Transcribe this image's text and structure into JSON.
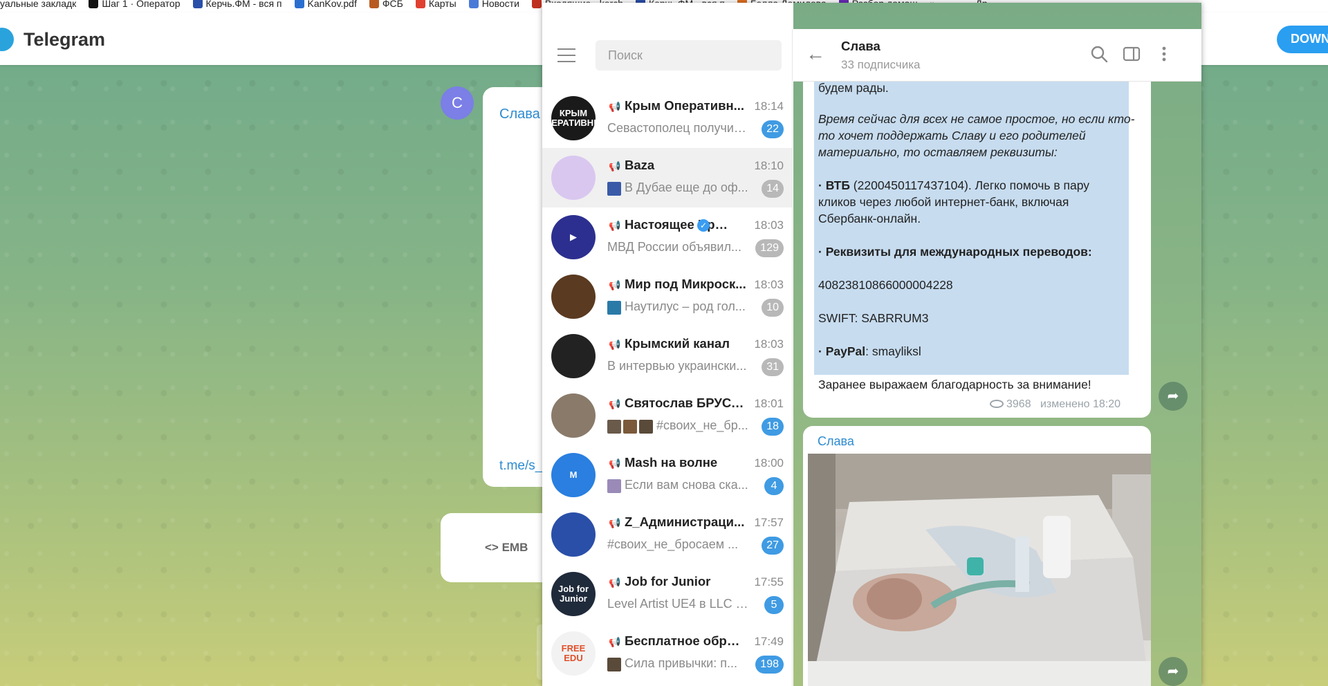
{
  "bookmarks": [
    {
      "label": "уальные закладк",
      "color": "#d0a020"
    },
    {
      "label": "Шаг 1 · Оператор",
      "color": "#111111"
    },
    {
      "label": "Керчь.ФМ - вся п",
      "color": "#2a4fa8"
    },
    {
      "label": "KanKov.pdf",
      "color": "#2a6fd0"
    },
    {
      "label": "ФСБ",
      "color": "#b85a20"
    },
    {
      "label": "Карты",
      "color": "#e04030"
    },
    {
      "label": "Новости",
      "color": "#4a7ad8"
    },
    {
      "label": "Входящие - kerch",
      "color": "#c03020"
    },
    {
      "label": "Керчь.ФМ - вся п",
      "color": "#2a4fa8"
    },
    {
      "label": "Бэлла Демидова",
      "color": "#e07020"
    },
    {
      "label": "Разбор домаш",
      "color": "#6a2ab8"
    }
  ],
  "bookmarks_more": "»",
  "bookmarks_tail": "Др",
  "web": {
    "title": "Telegram",
    "download_label": "DOWN",
    "post_avatar_letter": "С",
    "post_author": "Слава",
    "post_link": "t.me/s_",
    "embed_label": "<> EMB"
  },
  "window": {
    "min": "—",
    "max": "☐",
    "close": "✕"
  },
  "sidebar": {
    "search_placeholder": "Поиск",
    "chats": [
      {
        "name": "Крым Оперативн...",
        "time": "18:14",
        "preview": "Севастополец получил...",
        "badge": "22",
        "muted": false,
        "av_text": "КРЫМ ОПЕРАТИВНЫЙ",
        "av_color": "#1a1a1a"
      },
      {
        "name": "Baza",
        "time": "18:10",
        "preview": "В Дубае еще до оф...",
        "badge": "14",
        "muted": true,
        "av_text": "",
        "av_color": "#d9c7f0",
        "thumb_colors": [
          "#3a5aa8"
        ]
      },
      {
        "name": "Настоящее Вре...",
        "time": "18:03",
        "preview": "МВД России объявил...",
        "badge": "129",
        "muted": true,
        "av_text": "▶",
        "av_color": "#2c2f8f",
        "verified": true
      },
      {
        "name": "Мир под Микроск...",
        "time": "18:03",
        "preview": "Наутилус – род гол...",
        "badge": "10",
        "muted": true,
        "av_text": "",
        "av_color": "#5a3a20",
        "thumb_colors": [
          "#2a7aa8"
        ]
      },
      {
        "name": "Крымский канал",
        "time": "18:03",
        "preview": "В интервью украински...",
        "badge": "31",
        "muted": true,
        "av_text": "",
        "av_color": "#222222"
      },
      {
        "name": "Святослав БРУСА...",
        "time": "18:01",
        "preview": "#своих_не_бр...",
        "badge": "18",
        "muted": false,
        "av_text": "",
        "av_color": "#8a7a6a",
        "thumb_colors": [
          "#6a5a4a",
          "#7a5a3a",
          "#5a4a3a"
        ]
      },
      {
        "name": "Mash на волне",
        "time": "18:00",
        "preview": "Если вам снова ска...",
        "badge": "4",
        "muted": false,
        "av_text": "М",
        "av_color": "#2a7fe0",
        "thumb_colors": [
          "#9a8ab8"
        ]
      },
      {
        "name": "Z_Администраци...",
        "time": "17:57",
        "preview": "#своих_не_бросаем ...",
        "badge": "27",
        "muted": false,
        "av_text": "",
        "av_color": "#2a4fa8"
      },
      {
        "name": "Job for Junior",
        "time": "17:55",
        "preview": "Level Artist UE4 в LLC GF...",
        "badge": "5",
        "muted": false,
        "av_text": "Job for Junior",
        "av_color": "#1f2a3a"
      },
      {
        "name": "Бесплатное образ...",
        "time": "17:49",
        "preview": "Сила привычки: п...",
        "badge": "198",
        "muted": false,
        "av_text": "FREE EDU",
        "av_color": "#f2f2f2",
        "thumb_colors": [
          "#5a4a3a"
        ]
      }
    ]
  },
  "chat": {
    "title": "Слава",
    "subtitle": "33 подписчика",
    "message": {
      "line_top": "будем рады.",
      "italic": [
        "Время сейчас для всех не самое простое, но если кто-",
        "то хочет поддержать Славу и его родителей",
        "материально, то оставляем реквизиты:"
      ],
      "vtb_bold": "· ВТБ",
      "vtb_rest": " (2200450117437104). Легко помочь в пару",
      "vtb_line2": "кликов через любой интернет-банк, включая",
      "vtb_line3": "Сбербанк-онлайн.",
      "intl_bold": "· Реквизиты для международных переводов:",
      "account": "40823810866000004228",
      "swift": "SWIFT: SABRRUM3",
      "paypal_bold": "· PayPal",
      "paypal_rest": ": smayliksl",
      "thanks": "Заранее выражаем благодарность за внимание!",
      "views": "3968",
      "edited": "изменено 18:20"
    },
    "photo_author": "Слава"
  }
}
